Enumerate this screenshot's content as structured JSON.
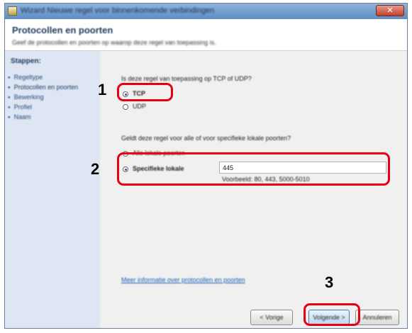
{
  "window": {
    "title": "Wizard Nieuwe regel voor binnenkomende verbindingen",
    "close_label": "✕"
  },
  "header": {
    "title": "Protocollen en poorten",
    "description": "Geef de protocollen en poorten op waarop deze regel van toepassing is."
  },
  "steps": {
    "title": "Stappen:",
    "items": [
      {
        "label": "Regeltype"
      },
      {
        "label": "Protocollen en poorten"
      },
      {
        "label": "Bewerking"
      },
      {
        "label": "Profiel"
      },
      {
        "label": "Naam"
      }
    ],
    "current_index": 1
  },
  "protocol": {
    "question": "Is deze regel van toepassing op TCP of UDP?",
    "options": [
      {
        "label": "TCP",
        "checked": true
      },
      {
        "label": "UDP",
        "checked": false
      }
    ]
  },
  "ports": {
    "question": "Geldt deze regel voor alle of voor specifieke lokale poorten?",
    "options": [
      {
        "label": "Alle lokale poorten",
        "checked": false
      },
      {
        "label": "Specifieke lokale",
        "checked": true
      }
    ],
    "value": "445",
    "example": "Voorbeeld: 80, 443, 5000-5010"
  },
  "link_text": "Meer informatie over protocollen en poorten",
  "buttons": {
    "back": "< Vorige",
    "next": "Volgende >",
    "cancel": "Annuleren"
  },
  "callouts": {
    "one": "1",
    "two": "2",
    "three": "3"
  },
  "colors": {
    "highlight": "#e60012",
    "titlebar": "#5f8cc4",
    "steps_panel": "#dde6f2"
  }
}
